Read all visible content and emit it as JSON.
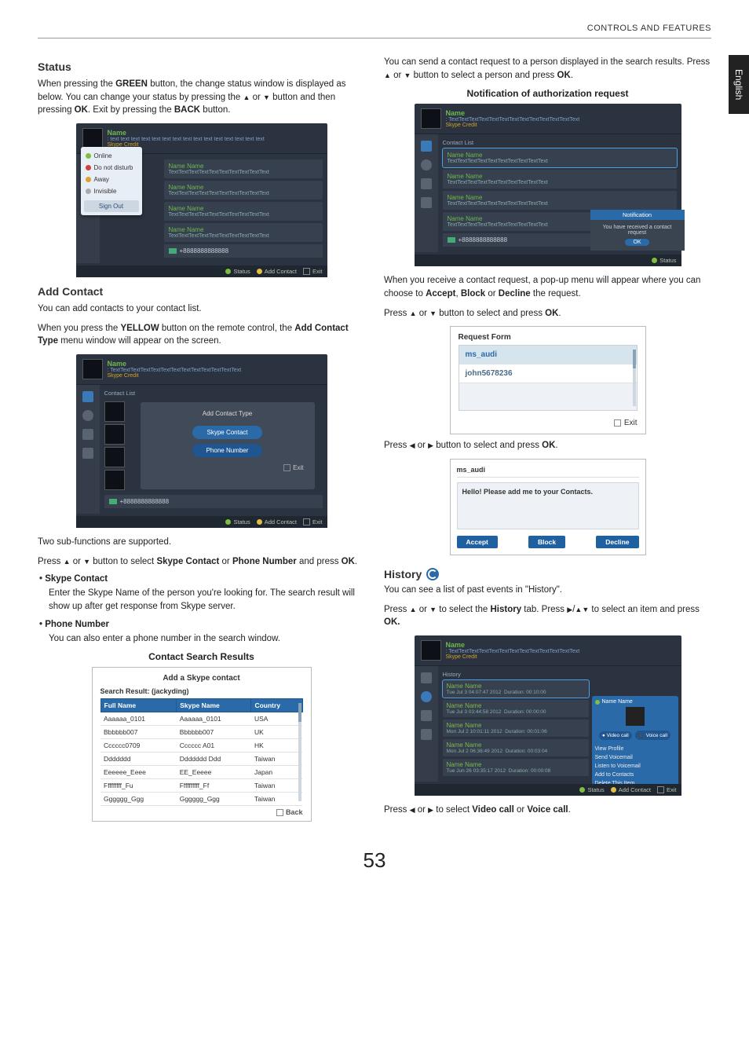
{
  "header": {
    "section_title": "CONTROLS AND FEATURES",
    "lang_tab": "English"
  },
  "status": {
    "heading": "Status",
    "p1a": "When pressing the ",
    "p1b": " button, the change status window is displayed as below. You can change your status by pressing the ",
    "green": "GREEN",
    "p1c": " or ",
    "p1d": " button and then pressing ",
    "ok": "OK",
    "p1e": ". Exit by pressing the ",
    "back": "BACK",
    "p1f": " button.",
    "panel": {
      "name": "Name",
      "mood": ": text text text text text text text text text text text text text text text",
      "credit": "Skype Credit",
      "menu": {
        "online": "Online",
        "dnd": "Do not disturb",
        "away": "Away",
        "invisible": "Invisible",
        "signout": "Sign Out"
      },
      "row_name": "Name Name",
      "row_sub": "TextTextTextTextTextTextTextTextTextText",
      "phone": "+8888888888888",
      "footer": {
        "status": "Status",
        "add": "Add Contact",
        "exit": "Exit"
      }
    }
  },
  "addcontact": {
    "heading": "Add Contact",
    "p1": "You can add contacts to your contact list.",
    "p2a": "When you press the ",
    "yellow": "YELLOW",
    "p2b": " button on the remote control, the ",
    "menu_name": "Add Contact Type",
    "p2c": " menu window will appear on the screen.",
    "panel": {
      "name": "Name",
      "mood": ": TextTextTextTextTextTextTextTextTextTextTextTextText",
      "credit": "Skype Credit",
      "list_label": "Contact List",
      "popup_title": "Add Contact Type",
      "btn1": "Skype Contact",
      "btn2": "Phone Number",
      "exit": "Exit",
      "phone": "+8888888888888",
      "footer": {
        "status": "Status",
        "add": "Add Contact",
        "exit": "Exit"
      }
    },
    "p3": "Two sub-functions are supported.",
    "p4a": "Press ",
    "p4b": " or ",
    "p4c": " button to select ",
    "sc": "Skype Contact",
    "p4d": " or ",
    "pn": "Phone Number",
    "p4e": " and press ",
    "ok": "OK",
    "p4f": ".",
    "b1": "Skype Contact",
    "b1p": "Enter the Skype Name of the person you're looking for. The search result will show up after get response from Skype server.",
    "b2": "Phone Number",
    "b2p": "You can also enter a phone number in the search window.",
    "results_caption": "Contact Search Results",
    "results": {
      "title": "Add a Skype contact",
      "sub": "Search Result: (jackyding)",
      "cols": {
        "c1": "Full Name",
        "c2": "Skype Name",
        "c3": "Country"
      },
      "rows": [
        {
          "full": "Aaaaaa_0101",
          "skype": "Aaaaaa_0101",
          "country": "USA"
        },
        {
          "full": "Bbbbbb007",
          "skype": "Bbbbbb007",
          "country": "UK"
        },
        {
          "full": "Cccccc0709",
          "skype": "Cccccc A01",
          "country": "HK"
        },
        {
          "full": "Ddddddd",
          "skype": "Ddddddd Ddd",
          "country": "Taiwan"
        },
        {
          "full": "Eeeeee_Eeee",
          "skype": "EE_Eeeee",
          "country": "Japan"
        },
        {
          "full": "Fffffffff_Fu",
          "skype": "Ffffffffff_Ff",
          "country": "Taiwan"
        },
        {
          "full": "Gggggg_Ggg",
          "skype": "Gggggg_Ggg",
          "country": "Taiwan"
        }
      ],
      "back": "Back"
    }
  },
  "right": {
    "p1a": "You can send a contact request to a person displayed in the search results. Press ",
    "p1b": " or ",
    "p1c": " button to select a person and press ",
    "ok": "OK",
    "p1d": ".",
    "notif_caption": "Notification of authorization request",
    "notif_panel": {
      "name": "Name",
      "mood": ": TextTextTextTextTextTextTextTextTextTextTextTextText",
      "credit": "Skype Credit",
      "list": "Contact List",
      "row_name": "Name Name",
      "row_sub": "TextTextTextTextTextTextTextTextTextText",
      "phone": "+8888888888888",
      "pop_h": "Notification",
      "pop_b": "You have received a contact request",
      "pop_ok": "OK",
      "footer": {
        "status": "Status"
      }
    },
    "p2a": "When you receive a contact request, a pop-up menu will appear where you can choose to ",
    "accept": "Accept",
    "p2b": ", ",
    "block": "Block",
    "p2c": " or ",
    "decline": "Decline",
    "p2d": " the request.",
    "p3a": "Press ",
    "p3b": " or ",
    "p3c": " button to select and press ",
    "ok2": "OK",
    "p3d": ".",
    "req": {
      "title": "Request Form",
      "item1": "ms_audi",
      "item2": "john5678236",
      "exit": "Exit"
    },
    "p4a": "Press ",
    "p4b": " or ",
    "p4c": " button to select and press ",
    "ok3": "OK",
    "p4d": ".",
    "msg": {
      "name": "ms_audi",
      "text": "Hello! Please add me to your Contacts.",
      "accept": "Accept",
      "block": "Block",
      "decline": "Decline"
    },
    "history": {
      "heading": "History",
      "p1": "You can see a list of past events in \"History\".",
      "p2a": "Press ",
      "p2b": " or ",
      "p2c": " to select the ",
      "tab": "History",
      "p2d": " tab. Press ",
      "p2e": "/",
      "p2f": " to select an item and press ",
      "ok": "OK.",
      "panel": {
        "name": "Name",
        "mood": ": TextTextTextTextTextTextTextTextTextTextTextTextText",
        "credit": "Skype Credit",
        "tab": "History",
        "items": [
          {
            "n": "Name Name",
            "t": "Tue Jul 3 04:07:47 2012",
            "d": "Duration: 00:10:00"
          },
          {
            "n": "Name Name",
            "t": "Tue Jul 3 03:44:58 2012",
            "d": "Duration: 00:00:00"
          },
          {
            "n": "Name Name",
            "t": "Mon Jul 2 10:01:11 2012",
            "d": "Duration: 00:01:06"
          },
          {
            "n": "Name Name",
            "t": "Mon Jul 2 06:36:49 2012",
            "d": "Duration: 00:03:04"
          },
          {
            "n": "Name Name",
            "t": "Tue Jun 26 03:35:17 2012",
            "d": "Duration: 00:00:08"
          }
        ],
        "side": {
          "name": "Name Name",
          "video": "Video call",
          "voice": "Voice call",
          "links": [
            "View Profile",
            "Send Voicemail",
            "Listen to Voicemail",
            "Add to Contacts",
            "Delete This Item"
          ]
        },
        "footer": {
          "status": "Status",
          "add": "Add Contact",
          "exit": "Exit"
        }
      },
      "p3a": "Press ",
      "p3b": " or ",
      "p3c": " to select ",
      "vc": "Video call",
      "p3d": " or ",
      "voc": "Voice call",
      "p3e": "."
    }
  },
  "page_number": "53"
}
